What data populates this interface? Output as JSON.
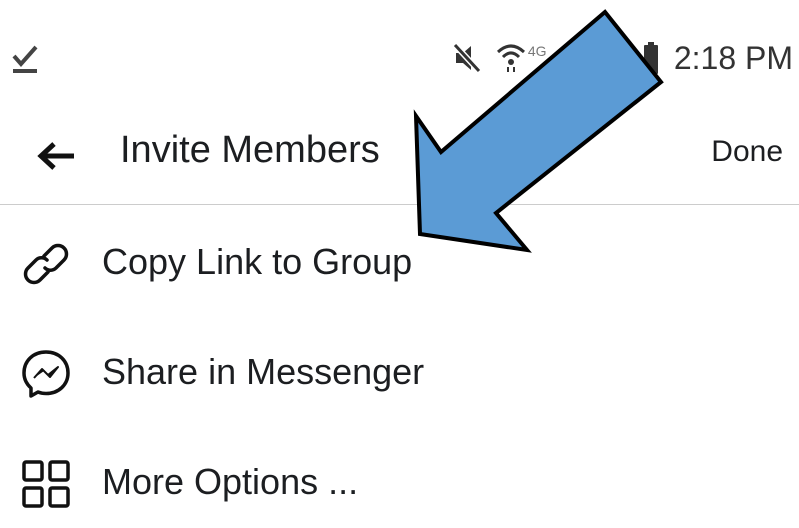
{
  "status_bar": {
    "time": "2:18 PM",
    "network_label": "4G",
    "icons": [
      "download-done-icon",
      "mute-icon",
      "wifi-icon",
      "battery-icon"
    ]
  },
  "header": {
    "title": "Invite Members",
    "done_label": "Done",
    "back_icon": "back-arrow-icon"
  },
  "menu": {
    "items": [
      {
        "label": "Copy Link to Group",
        "icon": "link-icon"
      },
      {
        "label": "Share in Messenger",
        "icon": "messenger-icon"
      },
      {
        "label": "More Options ...",
        "icon": "grid-icon"
      }
    ]
  },
  "annotation": {
    "icon": "pointer-arrow-icon",
    "fill_color": "#5b9bd5",
    "stroke_color": "#000000"
  },
  "colors": {
    "text": "#1c1e21",
    "divider": "#cccccc",
    "background": "#ffffff"
  }
}
